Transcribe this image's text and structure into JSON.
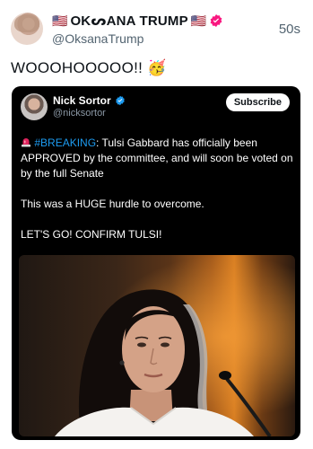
{
  "post": {
    "author_flag_left": "🇺🇸",
    "author_name": "OKᔕANA TRUMP",
    "author_flag_right": "🇺🇸",
    "handle": "@OksanaTrump",
    "time": "50s",
    "text": "WOOOHOOOOO!! 🥳"
  },
  "quote": {
    "author_name": "Nick Sortor",
    "handle": "@nicksortor",
    "subscribe_label": "Subscribe",
    "hashtag": "#BREAKING",
    "paragraph1_rest": ": Tulsi Gabbard has officially been APPROVED by the committee, and will soon be voted on by the full Senate",
    "paragraph2": "This was a HUGE hurdle to overcome.",
    "paragraph3": "LET'S GO! CONFIRM TULSI!"
  },
  "colors": {
    "verified_pink": "#f91880",
    "verified_blue": "#1d9bf0",
    "hashtag": "#1d9bf0",
    "muted": "#536471"
  },
  "icons": {
    "verified": "verified-badge-icon",
    "siren": "siren-icon"
  }
}
